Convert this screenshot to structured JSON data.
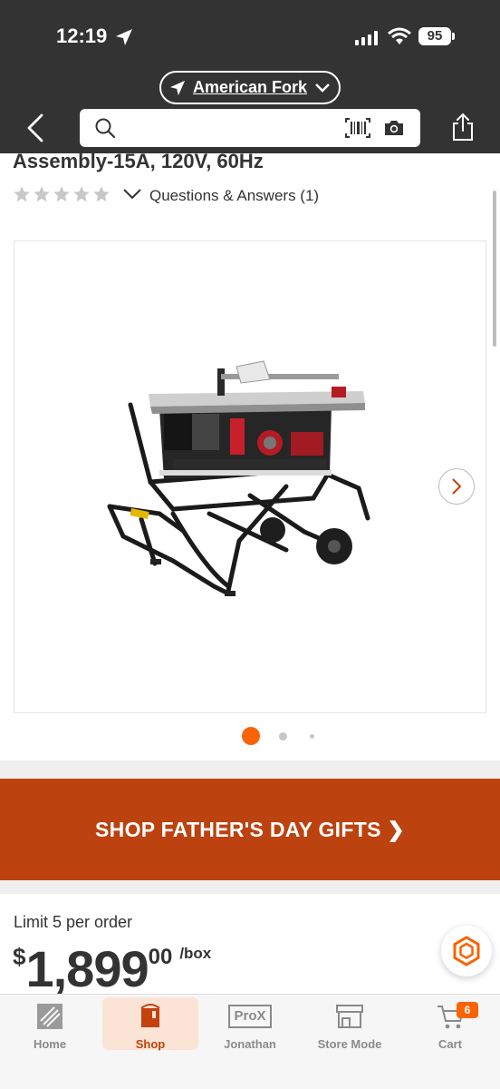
{
  "status_bar": {
    "time": "12:19",
    "battery": "95"
  },
  "header": {
    "store_name": "American Fork",
    "search": {
      "placeholder": "",
      "value": ""
    }
  },
  "product": {
    "title_fragment": "Assembly-15A, 120V, 60Hz",
    "rating": 0,
    "qa_label": "Questions & Answers (1)",
    "image_count": 3,
    "active_image_index": 0
  },
  "promo": {
    "text": "SHOP FATHER'S DAY GIFTS ❯"
  },
  "pricing": {
    "limit": "Limit 5 per order",
    "currency": "$",
    "dollars": "1,899",
    "cents": "00",
    "unit": "/box"
  },
  "bottom_nav": {
    "items": [
      {
        "label": "Home"
      },
      {
        "label": "Shop"
      },
      {
        "label": "Jonathan"
      },
      {
        "label": "Store Mode"
      },
      {
        "label": "Cart"
      }
    ],
    "active": "Shop",
    "cart_count": "6",
    "prox_badge": "ProX"
  },
  "colors": {
    "accent": "#f96302",
    "promo_bg": "#bc4210",
    "header_bg": "#333333"
  }
}
